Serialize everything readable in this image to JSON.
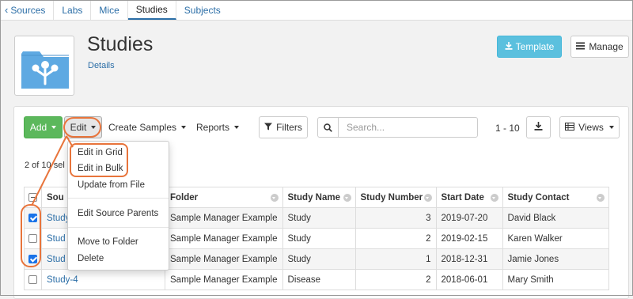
{
  "nav": {
    "back_label": "Sources",
    "tabs": [
      "Labs",
      "Mice",
      "Studies",
      "Subjects"
    ],
    "active_tab": "Studies"
  },
  "header": {
    "title": "Studies",
    "details_link": "Details",
    "template_button": "Template",
    "manage_button": "Manage",
    "icon": "folder-tree-icon"
  },
  "toolbar": {
    "add": "Add",
    "edit": "Edit",
    "create_samples": "Create Samples",
    "reports": "Reports",
    "filters": "Filters",
    "search_placeholder": "Search...",
    "paging": "1 - 10",
    "views": "Views"
  },
  "selection_text": "2 of 10 sel",
  "edit_menu": {
    "items": [
      "Edit in Grid",
      "Edit in Bulk",
      "Update from File",
      "Edit Source Parents",
      "Move to Folder",
      "Delete"
    ]
  },
  "grid": {
    "columns": [
      "Sou",
      "Folder",
      "Study Name",
      "Study Number",
      "Start Date",
      "Study Contact"
    ],
    "rows": [
      {
        "name": "Study",
        "folder": "Sample Manager Example",
        "study_name": "Study",
        "study_number": "3",
        "start_date": "2019-07-20",
        "contact": "David Black",
        "checked": true
      },
      {
        "name": "Stud",
        "folder": "Sample Manager Example",
        "study_name": "Study",
        "study_number": "2",
        "start_date": "2019-02-15",
        "contact": "Karen Walker",
        "checked": false
      },
      {
        "name": "Stud",
        "folder": "Sample Manager Example",
        "study_name": "Study",
        "study_number": "1",
        "start_date": "2018-12-31",
        "contact": "Jamie Jones",
        "checked": true
      },
      {
        "name": "Study-4",
        "folder": "Sample Manager Example",
        "study_name": "Disease",
        "study_number": "2",
        "start_date": "2018-06-01",
        "contact": "Mary Smith",
        "checked": false
      }
    ]
  },
  "colors": {
    "add_green": "#5cb85c",
    "template_blue": "#5bc0de",
    "link_blue": "#2b6ea7",
    "annotation_orange": "#e8743b",
    "icon_blue": "#5ea9e2"
  }
}
